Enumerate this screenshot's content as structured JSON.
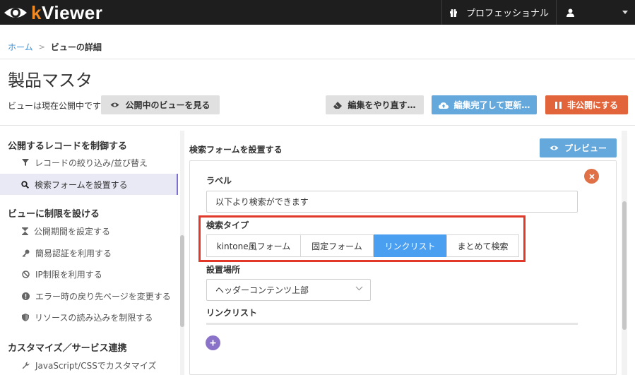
{
  "app": {
    "logo_k": "k",
    "logo_rest": "Viewer"
  },
  "topbar": {
    "plan_label": "プロフェッショナル",
    "plan_icon": "gift-icon",
    "user_icon": "user-icon"
  },
  "breadcrumb": {
    "home": "ホーム",
    "separator": ">",
    "current": "ビューの詳細"
  },
  "page": {
    "title": "製品マスタ",
    "status_text": "ビューは現在公開中です",
    "view_public_button": "公開中のビューを見る",
    "redo_button": "編集をやり直す…",
    "complete_button": "編集完了して更新…",
    "unpublish_button": "非公開にする"
  },
  "sidebar": {
    "sections": [
      {
        "title": "公開するレコードを制御する",
        "items": [
          {
            "label": "レコードの絞り込み/並び替え",
            "icon": "filter-icon"
          },
          {
            "label": "検索フォームを設置する",
            "icon": "search-icon",
            "active": true
          }
        ]
      },
      {
        "title": "ビューに制限を設ける",
        "items": [
          {
            "label": "公開期間を設定する",
            "icon": "hourglass-icon"
          },
          {
            "label": "簡易認証を利用する",
            "icon": "key-icon"
          },
          {
            "label": "IP制限を利用する",
            "icon": "ban-icon"
          },
          {
            "label": "エラー時の戻り先ページを変更する",
            "icon": "exclamation-icon"
          },
          {
            "label": "リソースの読み込みを制限する",
            "icon": "shield-icon"
          }
        ]
      },
      {
        "title": "カスタマイズ／サービス連携",
        "items": [
          {
            "label": "JavaScript/CSSでカスタマイズ",
            "icon": "wrench-icon"
          }
        ]
      }
    ]
  },
  "main": {
    "title": "検索フォームを設置する",
    "preview_button": "プレビュー",
    "label_heading": "ラベル",
    "label_value": "以下より検索ができます",
    "search_type_heading": "検索タイプ",
    "search_types": [
      "kintone風フォーム",
      "固定フォーム",
      "リンクリスト",
      "まとめて検索"
    ],
    "selected_search_type": "リンクリスト",
    "placement_heading": "設置場所",
    "placement_value": "ヘッダーコンテンツ上部",
    "linklist_heading": "リンクリスト"
  },
  "colors": {
    "accent_blue": "#4a9ff1",
    "button_blue": "#64a8dc",
    "danger_orange": "#e2643a",
    "highlight_red": "#e2382a",
    "purple": "#8a72c8"
  }
}
